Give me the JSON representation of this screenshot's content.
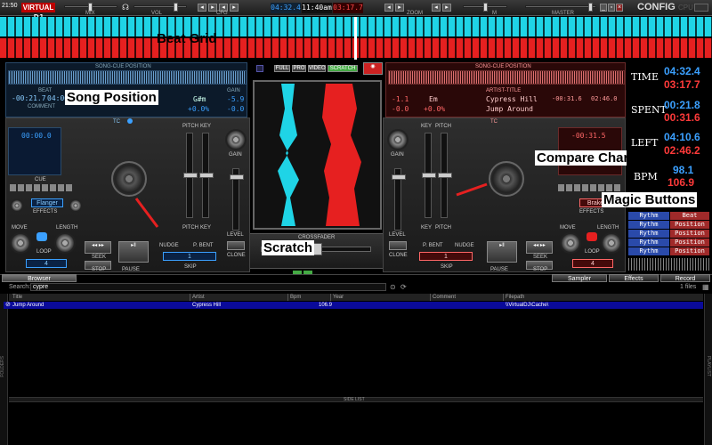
{
  "topbar": {
    "corner_time": "21:50",
    "logo": "VIRTUAL DJ",
    "mix_label": "MIX",
    "vol_label": "VOL",
    "cfg_label": "CFG",
    "zoom_label": "ZOOM",
    "master_label": "MASTER",
    "m_label": "M",
    "clock_left": "04:32.4",
    "clock_mid": "11:40am",
    "clock_right": "03:17.7",
    "config": "CONFIG",
    "cpu": "CPU"
  },
  "overlays": {
    "beat_grid": "Beat Grid",
    "song_position": "Song Position",
    "scratch": "Scratch",
    "compare_chart": "Compare Chart",
    "magic_buttons": "Magic Buttons"
  },
  "deck_left": {
    "title": "SONG-CUE POSITION",
    "beat_label": "BEAT",
    "time_a": "-00:21.7",
    "time_b": "04:00",
    "comment": "COMMENT",
    "key": "G#m",
    "pitch": "+0.0%",
    "gain": "-5.9",
    "gain2": "-0.0",
    "tc": "TC",
    "cue_time": "00:00.0",
    "cue_label": "CUE",
    "effect": "Flanger",
    "effects_label": "EFFECTS",
    "move_label": "MOVE",
    "length_label": "LENGTH",
    "loop_label": "LOOP",
    "loop_value": "4",
    "seek_label": "SEEK",
    "stop_label": "STOP",
    "pause_label": "PAUSE",
    "nudge_label": "NUDGE",
    "pbent_label": "P. BENT",
    "skip_label": "SKIP",
    "skip_value": "1",
    "pitch_label": "PITCH",
    "key_label": "KEY",
    "gain_label": "GAIN",
    "level_label": "LEVEL",
    "clone_label": "CLONE"
  },
  "deck_right": {
    "title": "SONG-CUE POSITION",
    "gain": "-1.1",
    "key": "Em",
    "artist": "Cypress Hill",
    "title2": "Jump Around",
    "pitch": "+0.0%",
    "gain2": "-0.0",
    "artist_title_label": "ARTIST-TITLE",
    "time_a": "-00:31.6",
    "time_b": "02:46.0",
    "cue_time": "-00:31.5",
    "effect": "Brake",
    "effects_label": "EFFECTS",
    "tc": "TC",
    "move_label": "MOVE",
    "length_label": "LENGTH",
    "loop_label": "LOOP",
    "loop_value": "4",
    "skip_value": "1",
    "seek_label": "SEEK",
    "stop_label": "STOP",
    "pause_label": "PAUSE",
    "nudge_label": "NUDGE",
    "pbent_label": "P. BENT",
    "skip_label": "SKIP",
    "pitch_label": "PITCH",
    "key_label": "KEY",
    "gain_label": "GAIN",
    "level_label": "LEVEL",
    "clone_label": "CLONE"
  },
  "center": {
    "buttons": [
      "FULL",
      "PRO",
      "VIDEO",
      "SCRATCH"
    ],
    "crossfader": "CROSSFADER"
  },
  "stats": {
    "time_label": "TIME",
    "time_blue": "04:32.4",
    "time_red": "03:17.7",
    "spent_label": "SPENT",
    "spent_blue": "00:21.8",
    "spent_red": "00:31.6",
    "left_label": "LEFT",
    "left_blue": "04:10.6",
    "left_red": "02:46.2",
    "bpm_label": "BPM",
    "bpm_blue": "98.1",
    "bpm_red": "106.9"
  },
  "magic": [
    {
      "left": "Rythm",
      "right": "Beat"
    },
    {
      "left": "Rythm",
      "right": "Position"
    },
    {
      "left": "Rythm",
      "right": "Position"
    },
    {
      "left": "Rythm",
      "right": "Position"
    },
    {
      "left": "Rythm",
      "right": "Position"
    }
  ],
  "browser": {
    "tab_browser": "Browser",
    "tab_sampler": "Sampler",
    "tab_effects": "Effects",
    "tab_record": "Record",
    "search_label": "Search:",
    "search_value": "cypre",
    "files_count": "1 files",
    "columns": [
      "Title",
      "Artist",
      "Bpm",
      "Year",
      "Comment",
      "Filepath"
    ],
    "row": {
      "title": "Jump Around",
      "artist": "Cypress Hill",
      "bpm": "106.9",
      "year": "",
      "comment": "",
      "filepath": "\\\\VirtualDJ\\Cache\\"
    },
    "side_list": "SIDE LIST",
    "folders": "FOLDERS",
    "playlist": "PLAYLIST"
  },
  "colors": {
    "deck_blue": "#1fd4e6",
    "deck_red": "#e62020",
    "stat_blue": "#3ba0ff",
    "stat_red": "#ff3a3a"
  }
}
